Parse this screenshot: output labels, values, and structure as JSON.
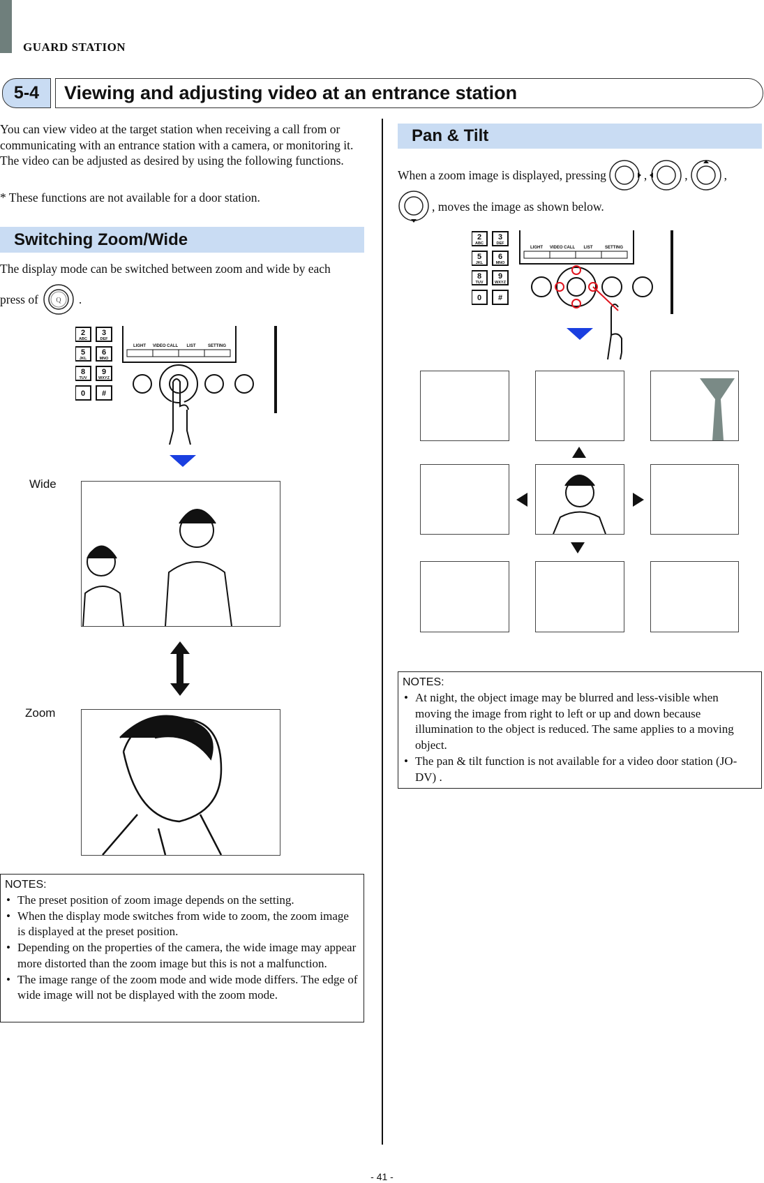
{
  "header": {
    "section": "GUARD STATION",
    "number": "5-4",
    "title": "Viewing and adjusting video at an entrance station"
  },
  "intro": {
    "text": "You can view video at the target station when receiving a call from or communicating with an entrance station with a camera, or monitoring it. The video can be adjusted as desired by using the following functions.",
    "footnote": "* These functions are not available for a door station."
  },
  "zoom_wide": {
    "heading": "Switching Zoom/Wide",
    "text": "The display mode can be switched between zoom and wide by each",
    "press_of": "press of",
    "period": ".",
    "wide_label": "Wide",
    "zoom_label": "Zoom",
    "notes_title": "NOTES:",
    "notes": [
      "The preset position of zoom image depends on the setting.",
      "When the display mode switches from wide to zoom, the zoom image is displayed at the preset position.",
      "Depending on the properties of the camera, the wide image may appear more distorted than the zoom image but this is not a malfunction.",
      "The image range of the zoom mode and wide mode differs. The edge of wide image will not be displayed with the zoom mode."
    ]
  },
  "pan_tilt": {
    "heading": "Pan & Tilt",
    "text_before": "When a zoom image is displayed, pressing",
    "text_after": ", moves the image as shown below.",
    "notes_title": "NOTES:",
    "notes": [
      "At night, the object image may be blurred and less-visible when moving the image from right to left or up and down because illumination to the object is reduced. The same applies to a moving object.",
      "The pan & tilt function is not available for a video door station (JO-DV) ."
    ]
  },
  "keypad": {
    "keys": [
      [
        "2",
        "ABC"
      ],
      [
        "3",
        "DEF"
      ],
      [
        "5",
        "JKL"
      ],
      [
        "6",
        "MNO"
      ],
      [
        "8",
        "TUV"
      ],
      [
        "9",
        "WXYZ"
      ],
      [
        "0",
        ""
      ],
      [
        "#",
        ""
      ]
    ],
    "softkeys": [
      "LIGHT",
      "VIDEO CALL",
      "LIST",
      "SETTING"
    ]
  },
  "footer": {
    "page": "- 41 -"
  },
  "colors": {
    "section_bg": "#c9dcf3",
    "accent_arrow": "#1a3fe0",
    "highlight": "#e0141e",
    "tab_bar": "#6f7f7c"
  }
}
